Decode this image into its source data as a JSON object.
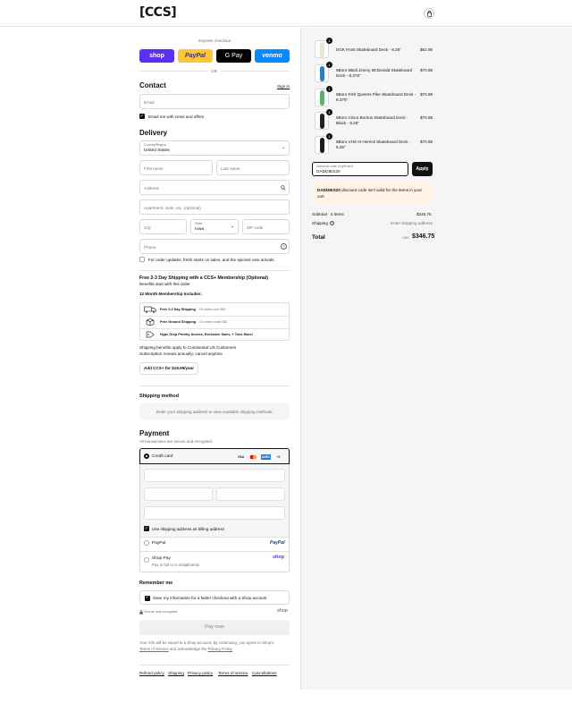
{
  "brand": {
    "logo": "[CCS]"
  },
  "express": {
    "title": "Express checkout",
    "or": "OR",
    "buttons": [
      {
        "label": "shop",
        "color": "#5a31f4"
      },
      {
        "label": "PayPal",
        "color": "#ffc439"
      },
      {
        "label": "G Pay",
        "color": "#000000"
      },
      {
        "label": "venmo",
        "color": "#008cff"
      }
    ]
  },
  "contact": {
    "heading": "Contact",
    "sign_in": "Sign in",
    "email_placeholder": "Email",
    "email_news_label": "Email me with news and offers"
  },
  "delivery": {
    "heading": "Delivery",
    "country_label": "Country/Region",
    "country_value": "United States",
    "first_name": "First name",
    "last_name": "Last name",
    "address": "Address",
    "apartment": "Apartment, suite, etc. (optional)",
    "city": "City",
    "state_label": "State",
    "state_value": "Iowa",
    "zip": "ZIP code",
    "phone": "Phone",
    "sms_label": "For order updates, fresh starts on sales, and the spiciest new arrivals."
  },
  "membership": {
    "title": "Free 2-3 Day Shipping with a CCS+ Membership (Optional)",
    "subtitle": "Benefits start with this order",
    "includes_label": "12 Month Membership Includes:",
    "benefits": [
      {
        "main": "Free 2-3 Day Shipping",
        "sub": "On orders over $60"
      },
      {
        "main": "Free Ground Shipping",
        "sub": "On orders under $60"
      },
      {
        "main": "Hype Drop Priority Access, Exclusive Sales, + Tons More!",
        "sub": ""
      }
    ],
    "note1": "Shipping benefits apply to Continental US Customers",
    "note2": "Subscription renews annually; cancel anytime",
    "add_button": "Add CCS+ for $19.99/year"
  },
  "shipping_method": {
    "heading": "Shipping method",
    "placeholder": "Enter your shipping address to view available shipping methods."
  },
  "payment": {
    "heading": "Payment",
    "subtitle": "All transactions are secure and encrypted.",
    "credit_card_label": "Credit card",
    "card_brands": [
      "VISA",
      "MC",
      "AMEX",
      "+5"
    ],
    "use_shipping_label": "Use shipping address as billing address",
    "paypal_label": "PayPal",
    "paypal_logo": "PayPal",
    "shop_pay_label": "Shop Pay",
    "shop_pay_sub": "Pay in full or in installments",
    "shop_pay_logo": "shop"
  },
  "remember": {
    "heading": "Remember me",
    "save_label": "Save my information for a faster checkout with a Shop account",
    "secure": "Secure and encrypted",
    "shop_logo": "shop"
  },
  "pay_now": "Pay now",
  "legal": {
    "line1": "Your info will be saved to a Shop account. By continuing, you agree to Shop's",
    "terms": "Terms of Service",
    "and_ack": "and acknowledge the",
    "privacy": "Privacy Policy"
  },
  "footer_links": [
    "Refund policy",
    "Shipping",
    "Privacy policy",
    "Terms of service",
    "Cancellations"
  ],
  "cart": {
    "items": [
      {
        "name": "DGK Frost Skateboard Deck - 8.25\"",
        "name2": "",
        "price": "$62.95",
        "qty": "1",
        "deck_color": "#e9e4dc"
      },
      {
        "name": "5Boro 5Ball Jimmy McDonald Skateboard",
        "name2": "Deck - 8.375\"",
        "price": "$70.95",
        "qty": "1",
        "deck_color": "#2f7bbd"
      },
      {
        "name": "5Boro Fish Queens Pike Skateboard Deck -",
        "name2": "8.375\"",
        "price": "$70.95",
        "qty": "1",
        "deck_color": "#5fae74"
      },
      {
        "name": "5Boro Cinco Berrios Skateboard Deck -",
        "name2": "Black - 8.25\"",
        "price": "$70.95",
        "qty": "1",
        "deck_color": "#222222"
      },
      {
        "name": "5Boro VHS III Herrick Skateboard Deck -",
        "name2": "8.25\"",
        "price": "$70.95",
        "qty": "1",
        "deck_color": "#1a1a1a"
      }
    ],
    "discount_label": "Discount code or gift card",
    "discount_value": "DADDIES20",
    "apply": "Apply",
    "error_code": "DADDIES20",
    "error_text1": "discount code isn't valid for the items in your",
    "error_text2": "cart",
    "subtotal_label": "Subtotal · 5 items",
    "subtotal_value": "$346.75",
    "shipping_label": "Shipping",
    "shipping_value": "Enter shipping address",
    "total_label": "Total",
    "currency": "USD",
    "total_value": "$346.75"
  }
}
